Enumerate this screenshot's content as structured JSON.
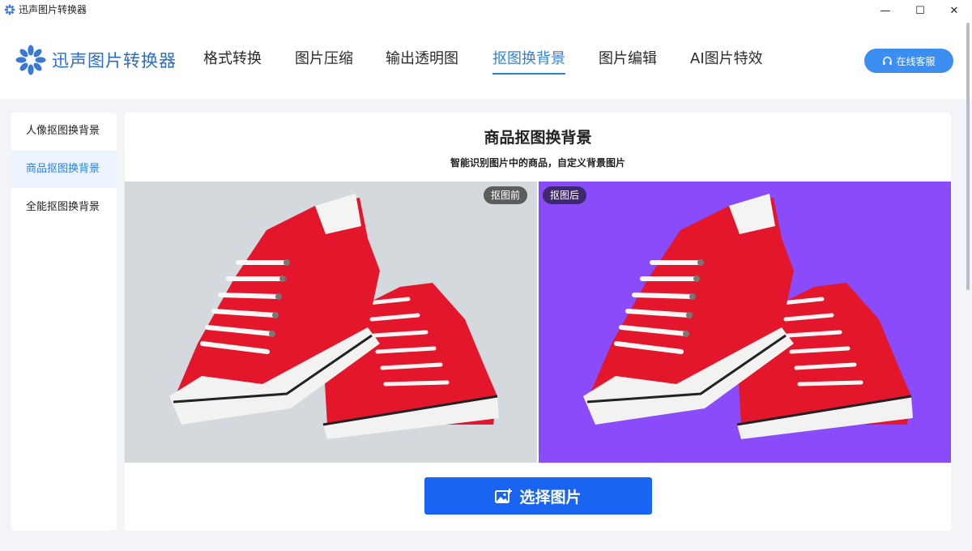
{
  "window": {
    "title": "迅声图片转换器",
    "minimize_glyph": "—",
    "maximize_glyph": "☐",
    "close_glyph": "✕"
  },
  "header": {
    "logo_text": "迅声图片转换器",
    "nav": [
      "格式转换",
      "图片压缩",
      "输出透明图",
      "抠图换背景",
      "图片编辑",
      "AI图片特效"
    ],
    "active_nav_index": 3,
    "support_label": "在线客服"
  },
  "sidebar": {
    "items": [
      "人像抠图换背景",
      "商品抠图换背景",
      "全能抠图换背景"
    ],
    "active_index": 1
  },
  "main": {
    "title": "商品抠图换背景",
    "subtitle": "智能识别图片中的商品，自定义背景图片",
    "before_tag": "抠图前",
    "after_tag": "抠图后",
    "choose_button_label": "选择图片"
  },
  "colors": {
    "accent": "#2f7fe0",
    "button": "#1a64f4",
    "before_bg": "#d3d9dd",
    "after_bg": "#8a4cfb",
    "shoe_red": "#e3162b"
  },
  "icons": [
    "app-logo-icon",
    "headset-icon",
    "add-image-icon"
  ]
}
